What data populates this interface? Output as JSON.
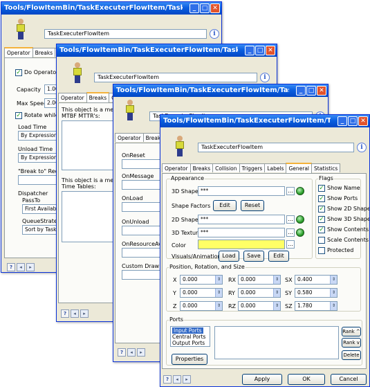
{
  "title": "Tools/FlowItemBin/TaskExecuterFlowItem/TaskExecuterFlowI...",
  "object_name": "TaskExecuterFlowItem",
  "window_buttons": {
    "minimize": "_",
    "maximize": "□",
    "close": "✕"
  },
  "nav_buttons": {
    "help": "?",
    "prev": "◂",
    "next": "▸"
  },
  "win1": {
    "tabs": [
      "Operator",
      "Breaks",
      "Co"
    ],
    "do_operator": "Do Operator Ani",
    "capacity_label": "Capacity",
    "capacity_value": "1.000",
    "max_speed_label": "Max Speed",
    "max_speed_value": "2.000",
    "rotate_label": "Rotate while tra",
    "load_time_label": "Load Time",
    "load_time_value": "By Expression Exp",
    "unload_time_label": "Unload Time",
    "unload_time_value": "By Expression Exp",
    "break_to_label": "\"Break to\" Requiren",
    "dispatcher_label": "Dispatcher",
    "pass_to_label": "PassTo",
    "pass_to_value": "First Available If",
    "queue_strategy_label": "QueueStrategy",
    "queue_strategy_value": "Sort by TaskSec"
  },
  "win2": {
    "tabs": [
      "Operator",
      "Breaks",
      "Colli"
    ],
    "mtbf_text_1": "This object is a member",
    "mtbf_text_2": "MTBF MTTR's:",
    "tt_text_1": "This object is a member",
    "tt_text_2": "Time Tables:"
  },
  "win3": {
    "tabs": [
      "Operator",
      "Breaks",
      "C"
    ],
    "labels": [
      "OnReset",
      "OnMessage",
      "OnLoad",
      "OnUnload",
      "OnResourceAvailab",
      "Custom Draw Code"
    ]
  },
  "win4": {
    "tabs": [
      "Operator",
      "Breaks",
      "Collision",
      "Triggers",
      "Labels",
      "General",
      "Statistics"
    ],
    "appearance": {
      "label": "Appearance",
      "shape_label": "3D Shape",
      "shape_value": "***",
      "shape_factors_label": "Shape Factors",
      "edit": "Edit",
      "reset": "Reset",
      "shape2d_label": "2D Shape",
      "shape2d_value": "***",
      "texture_label": "3D Texture",
      "texture_value": "***",
      "color_label": "Color",
      "color_value": "#ffff66",
      "visuals_label": "Visuals/Animations",
      "load": "Load",
      "save": "Save",
      "edit2": "Edit"
    },
    "flags": {
      "label": "Flags",
      "items": [
        {
          "label": "Show Name",
          "checked": true
        },
        {
          "label": "Show Ports",
          "checked": true
        },
        {
          "label": "Show 2D Shape",
          "checked": true
        },
        {
          "label": "Show 3D Shape",
          "checked": true
        },
        {
          "label": "Show Contents",
          "checked": true
        },
        {
          "label": "Scale Contents",
          "checked": false
        },
        {
          "label": "Protected",
          "checked": false
        }
      ]
    },
    "prs": {
      "label": "Position, Rotation, and Size",
      "x": {
        "label": "X",
        "value": "0.000"
      },
      "y": {
        "label": "Y",
        "value": "0.000"
      },
      "z": {
        "label": "Z",
        "value": "0.000"
      },
      "rx": {
        "label": "RX",
        "value": "0.000"
      },
      "ry": {
        "label": "RY",
        "value": "0.000"
      },
      "rz": {
        "label": "RZ",
        "value": "0.000"
      },
      "sx": {
        "label": "SX",
        "value": "0.400"
      },
      "sy": {
        "label": "SY",
        "value": "0.580"
      },
      "sz": {
        "label": "SZ",
        "value": "1.780"
      }
    },
    "ports": {
      "label": "Ports",
      "items": [
        "Input Ports",
        "Central Ports",
        "Output Ports"
      ],
      "rank_up": "Rank ^",
      "rank_down": "Rank v",
      "delete": "Delete",
      "properties": "Properties"
    },
    "apply": "Apply",
    "ok": "OK",
    "cancel": "Cancel"
  }
}
